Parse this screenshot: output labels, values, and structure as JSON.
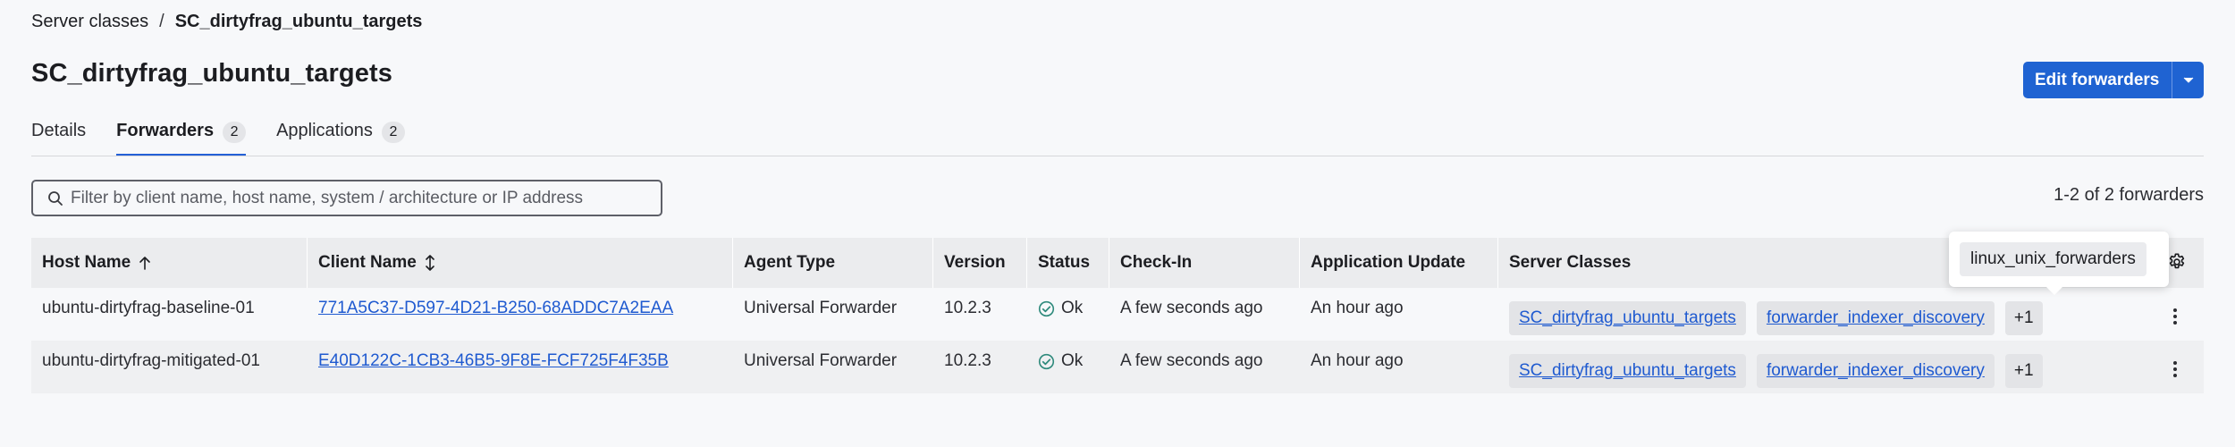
{
  "breadcrumb": {
    "parent": "Server classes",
    "separator": "/",
    "current": "SC_dirtyfrag_ubuntu_targets"
  },
  "page_title": "SC_dirtyfrag_ubuntu_targets",
  "actions": {
    "edit_forwarders_label": "Edit forwarders"
  },
  "tabs": [
    {
      "label": "Details",
      "count": ""
    },
    {
      "label": "Forwarders",
      "count": "2"
    },
    {
      "label": "Applications",
      "count": "2"
    }
  ],
  "filter": {
    "placeholder": "Filter by client name, host name, system / architecture or IP address",
    "value": ""
  },
  "result_count": "1-2 of 2 forwarders",
  "table": {
    "headers": [
      "Host Name",
      "Client Name",
      "Agent Type",
      "Version",
      "Status",
      "Check-In",
      "Application Update",
      "Server Classes"
    ],
    "rows": [
      {
        "host_name": "ubuntu-dirtyfrag-baseline-01",
        "client_name": "771A5C37-D597-4D21-B250-68ADDC7A2EAA",
        "agent_type": "Universal Forwarder",
        "version": "10.2.3",
        "status": "Ok",
        "check_in": "A few seconds ago",
        "application_update": "An hour ago",
        "server_classes": [
          "SC_dirtyfrag_ubuntu_targets",
          "forwarder_indexer_discovery"
        ],
        "more": "+1"
      },
      {
        "host_name": "ubuntu-dirtyfrag-mitigated-01",
        "client_name": "E40D122C-1CB3-46B5-9F8E-FCF725F4F35B",
        "agent_type": "Universal Forwarder",
        "version": "10.2.3",
        "status": "Ok",
        "check_in": "A few seconds ago",
        "application_update": "An hour ago",
        "server_classes": [
          "SC_dirtyfrag_ubuntu_targets",
          "forwarder_indexer_discovery"
        ],
        "more": "+1"
      }
    ]
  },
  "tooltip": {
    "text": "linux_unix_forwarders"
  },
  "colors": {
    "primary": "#1f63d2",
    "link": "#1f5ad0",
    "ok": "#2f8a7c",
    "tab_underline": "#2360d6"
  }
}
